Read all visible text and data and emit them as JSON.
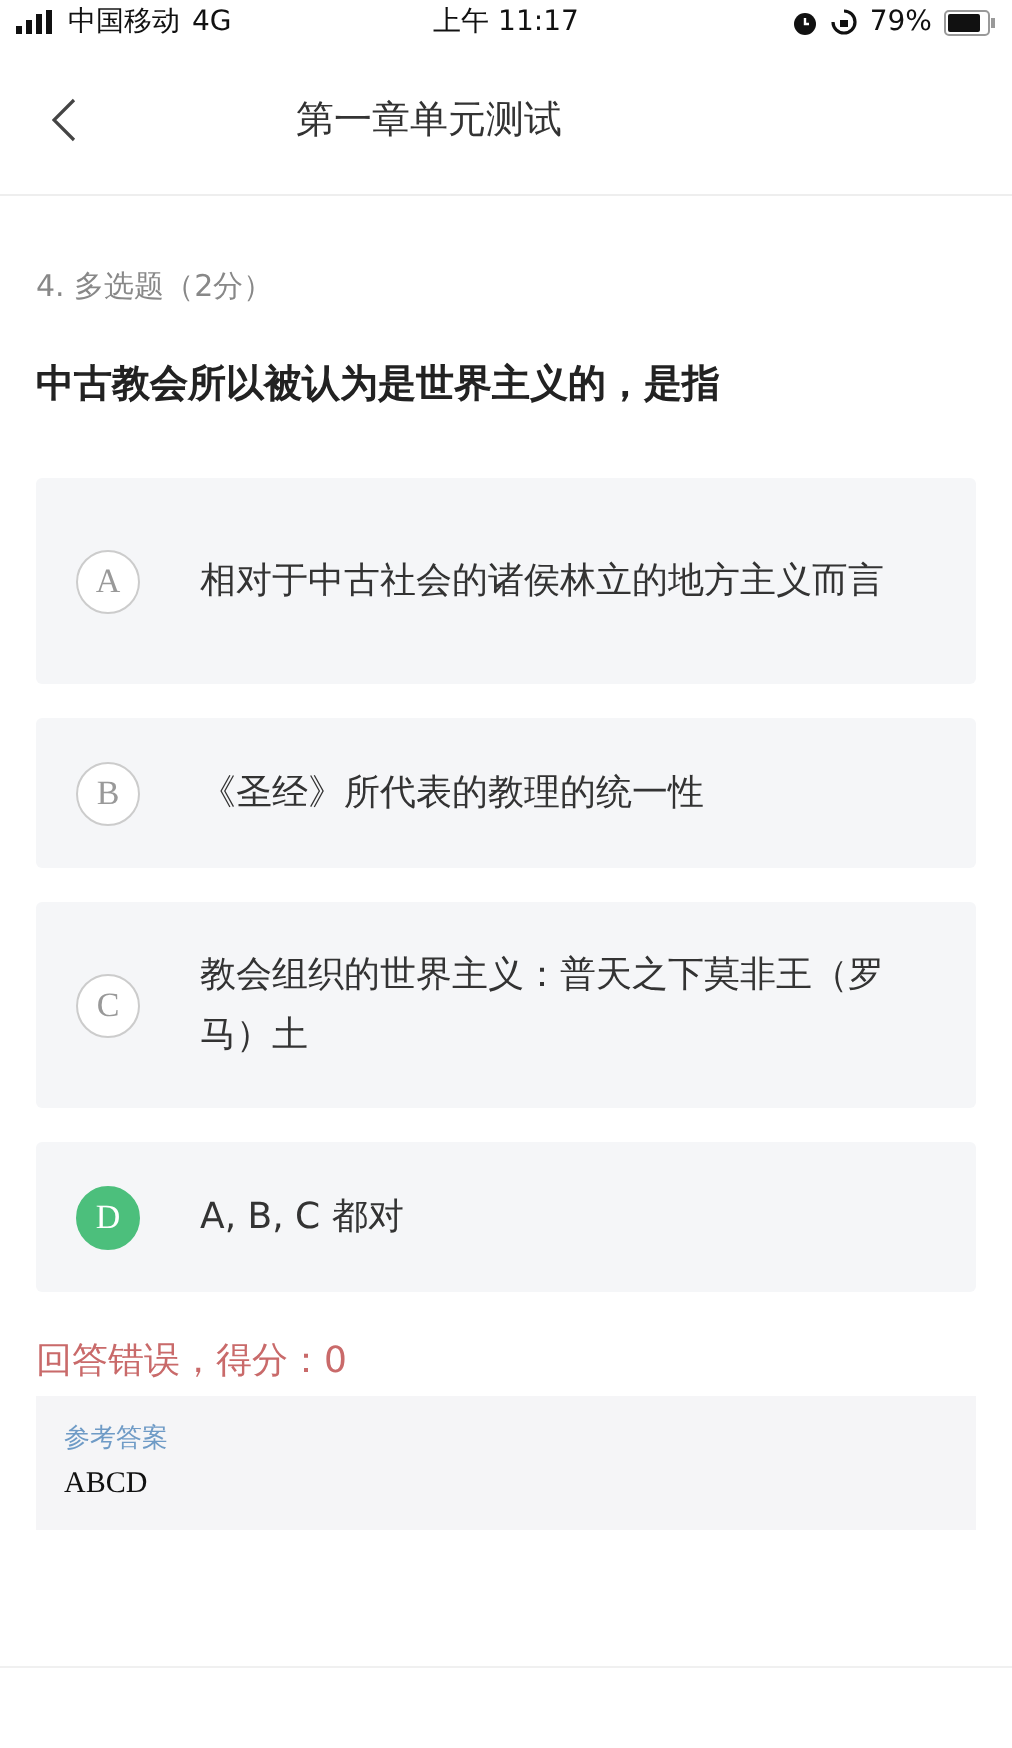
{
  "status_bar": {
    "carrier": "中国移动",
    "network": "4G",
    "time": "上午 11:17",
    "battery": "79%"
  },
  "header": {
    "title": "第一章单元测试"
  },
  "question": {
    "meta": "4. 多选题（2分）",
    "text": "中古教会所以被认为是世界主义的，是指"
  },
  "options": [
    {
      "letter": "A",
      "text": "相对于中古社会的诸侯林立的地方主义而言",
      "selected": false
    },
    {
      "letter": "B",
      "text": "《圣经》所代表的教理的统一性",
      "selected": false
    },
    {
      "letter": "C",
      "text": "教会组织的世界主义：普天之下莫非王（罗马）土",
      "selected": false
    },
    {
      "letter": "D",
      "text": "A, B, C 都对",
      "selected": true
    }
  ],
  "result": "回答错误，得分：0",
  "reference": {
    "label": "参考答案",
    "value": "ABCD"
  }
}
